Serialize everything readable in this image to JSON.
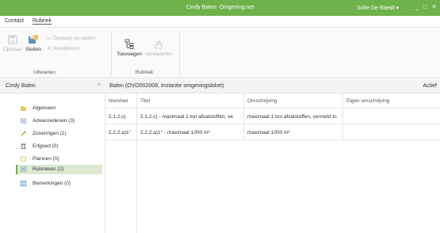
{
  "window": {
    "title": "Cindy Balen- Omgeving.net",
    "user": "Sofie De Raedt",
    "user_caret": "▾",
    "minimize": "_",
    "maximize": "□",
    "close": "✕"
  },
  "menu": {
    "items": [
      "Contact",
      "Rubriek"
    ]
  },
  "ribbon": {
    "save": "Opslaan",
    "close": "Sluiten",
    "save_close": "Opslaan en sluiten",
    "delete": "Verwijderen",
    "group1_label": "Uitvoeren",
    "add": "Toevoegen",
    "remove": "Verwijderen",
    "group2_label": "Rubriek"
  },
  "sidebar": {
    "title": "Cindy Balen",
    "collapse_icon": "˄",
    "items": [
      {
        "label": "Algemeen",
        "icon": "folder-icon",
        "color": "#e8c36a"
      },
      {
        "label": "Adviesredenen (3)",
        "icon": "document-icon",
        "color": "#6a8fb6"
      },
      {
        "label": "Zoneringen (1)",
        "icon": "zone-icon",
        "color": "#a4b846"
      },
      {
        "label": "Erfgoed (0)",
        "icon": "monument-icon",
        "color": "#7a6a5a"
      },
      {
        "label": "Plannen (0)",
        "icon": "plan-icon",
        "color": "#e8c36a"
      },
      {
        "label": "Rubrieken (2)",
        "icon": "list-icon",
        "color": "#6a8fb6"
      },
      {
        "label": "Bemerkingen (0)",
        "icon": "note-icon",
        "color": "#5a8ac6"
      }
    ]
  },
  "main": {
    "title": "Balen (OVO002008, Instantie omgevingsloket)",
    "status": "Actief",
    "columns": [
      "Nummer",
      "Titel",
      "Omschrijving",
      "Eigen omschrijving"
    ],
    "rows": [
      [
        "2.1.2.c)",
        "2.1.2.c) - maximaal 1 ton afvalstoffen, ve",
        "maximaal 1 ton afvalstoffen, vermeld in",
        ""
      ],
      [
        "2.2.2.a)1°",
        "2.2.2.a)1° - maximaal 1000 m³",
        "maximaal 1000 m³",
        ""
      ]
    ]
  },
  "colors": {
    "titlebar": "#6fb14a",
    "selected_item": "#dde8d2",
    "accent": "#6fb14a"
  }
}
